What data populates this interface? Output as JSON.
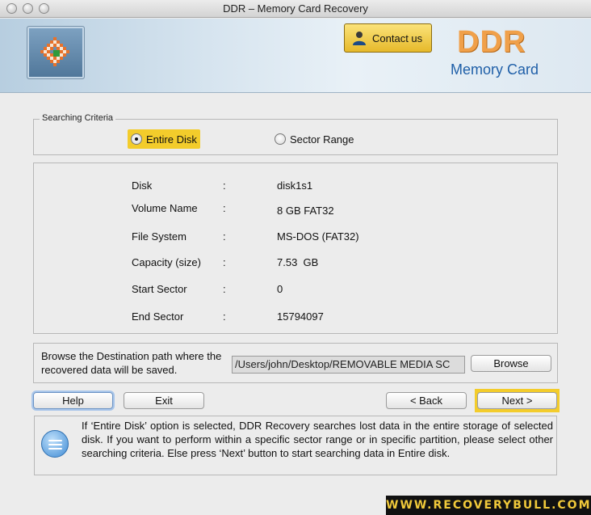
{
  "window": {
    "title": "DDR – Memory Card Recovery"
  },
  "header": {
    "contact_label": "Contact us",
    "brand_name": "DDR",
    "brand_product": "Memory Card"
  },
  "criteria": {
    "legend": "Searching Criteria",
    "options": [
      {
        "label": "Entire Disk",
        "selected": true
      },
      {
        "label": "Sector Range",
        "selected": false
      }
    ]
  },
  "disk_info": [
    {
      "label": "Disk",
      "colon": ":",
      "value": "disk1s1"
    },
    {
      "label": "Volume Name",
      "colon": ":",
      "value": "8 GB FAT32"
    },
    {
      "label": "File System",
      "colon": ":",
      "value": "MS-DOS (FAT32)"
    },
    {
      "label": "Capacity (size)",
      "colon": ":",
      "value": "7.53  GB"
    },
    {
      "label": "Start Sector",
      "colon": ":",
      "value": "0"
    },
    {
      "label": "End Sector",
      "colon": ":",
      "value": "15794097"
    }
  ],
  "destination": {
    "label": "Browse the Destination path where the recovered data will be saved.",
    "path_value": "/Users/john/Desktop/REMOVABLE MEDIA SC",
    "browse_label": "Browse"
  },
  "buttons": {
    "help": "Help",
    "exit": "Exit",
    "back": "< Back",
    "next": "Next >"
  },
  "help_text": "If ‘Entire Disk’ option is selected, DDR Recovery searches lost data in the entire storage of selected disk. If you want to perform within a specific sector range or in specific partition, please select other searching criteria. Else press ‘Next’ button to start searching data in Entire disk.",
  "watermark": "WWW.RECOVERYBULL.COM",
  "colors": {
    "highlight": "#f3cc2b",
    "brand_orange": "#f0a04a",
    "brand_blue": "#1f5fa8"
  }
}
